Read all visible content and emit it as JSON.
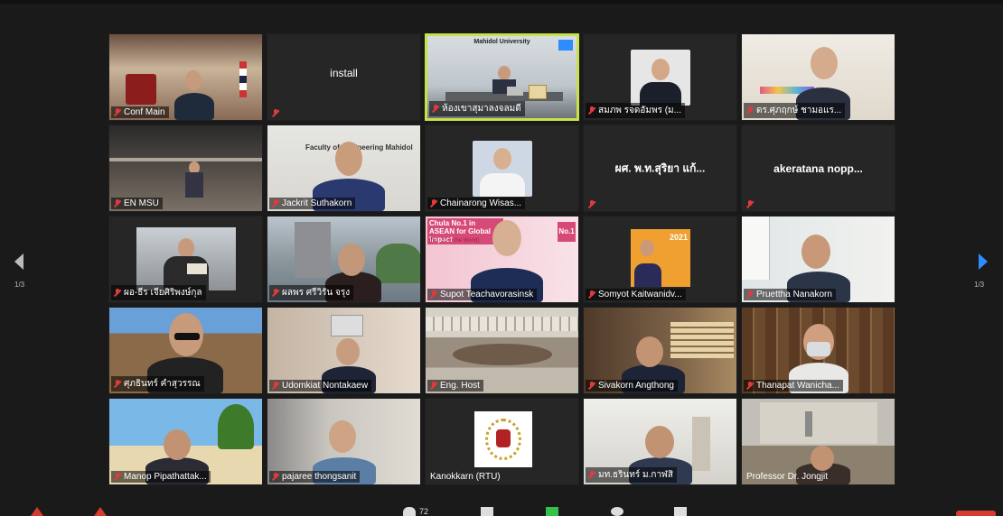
{
  "navigation": {
    "left_page": "1/3",
    "right_page": "1/3"
  },
  "participants": [
    {
      "name": "Conf Main"
    },
    {
      "name": "install",
      "center_name": "install"
    },
    {
      "name": "ห้องเขาสุมาลงจลมดี",
      "banner": "Mahidol University",
      "active": true
    },
    {
      "name": "สมภพ รจดอัมพร (ม..."
    },
    {
      "name": "ดร.ศุภฤกษ์ ชามอแร..."
    },
    {
      "name": "EN MSU"
    },
    {
      "name": "Jackrit Suthakorn",
      "banner": "Faculty of Engineering Mahidol"
    },
    {
      "name": "Chainarong Wisas..."
    },
    {
      "name": "ผศ. พ.ท.สุริยา แก้...",
      "center_name": "ผศ. พ.ท.สุริยา แก้..."
    },
    {
      "name": "akeratana nopp...",
      "center_name": "akeratana  nopp..."
    },
    {
      "name": "ผอ-ธีร เจียศิริพงษ์กุล"
    },
    {
      "name": "ผลพร ศรีวิรัน จรุง"
    },
    {
      "name": "Supot Teachavorasinsk",
      "banner": "Chula No.1 in ASEAN for Global Impact",
      "banner_sub": "(No. 23 in the World)",
      "badge": "No.1"
    },
    {
      "name": "Somyot Kaitwanidv...",
      "badge": "2021"
    },
    {
      "name": "Pruettha Nanakorn"
    },
    {
      "name": "ศุภธินทร์ คำสุวรรณ"
    },
    {
      "name": "Udomkiat Nontakaew"
    },
    {
      "name": "Eng. Host"
    },
    {
      "name": "Sivakorn Angthong"
    },
    {
      "name": "Thanapat Wanicha..."
    },
    {
      "name": "Manop Pipathattak..."
    },
    {
      "name": "pajaree thongsanit"
    },
    {
      "name": "Kanokkarn (RTU)"
    },
    {
      "name": "มท.ธรินทร์ ม.กาฬสิ"
    },
    {
      "name": "Professor Dr. Jongjit"
    }
  ],
  "toolbar": {
    "participants_count": "72"
  },
  "colors": {
    "background": "#1a1a1a",
    "tile": "#262626",
    "active_border": "#c8e04a",
    "muted_mic": "#e23a3a",
    "arrow_left": "#bbbbbb",
    "arrow_right": "#2d8cff"
  }
}
